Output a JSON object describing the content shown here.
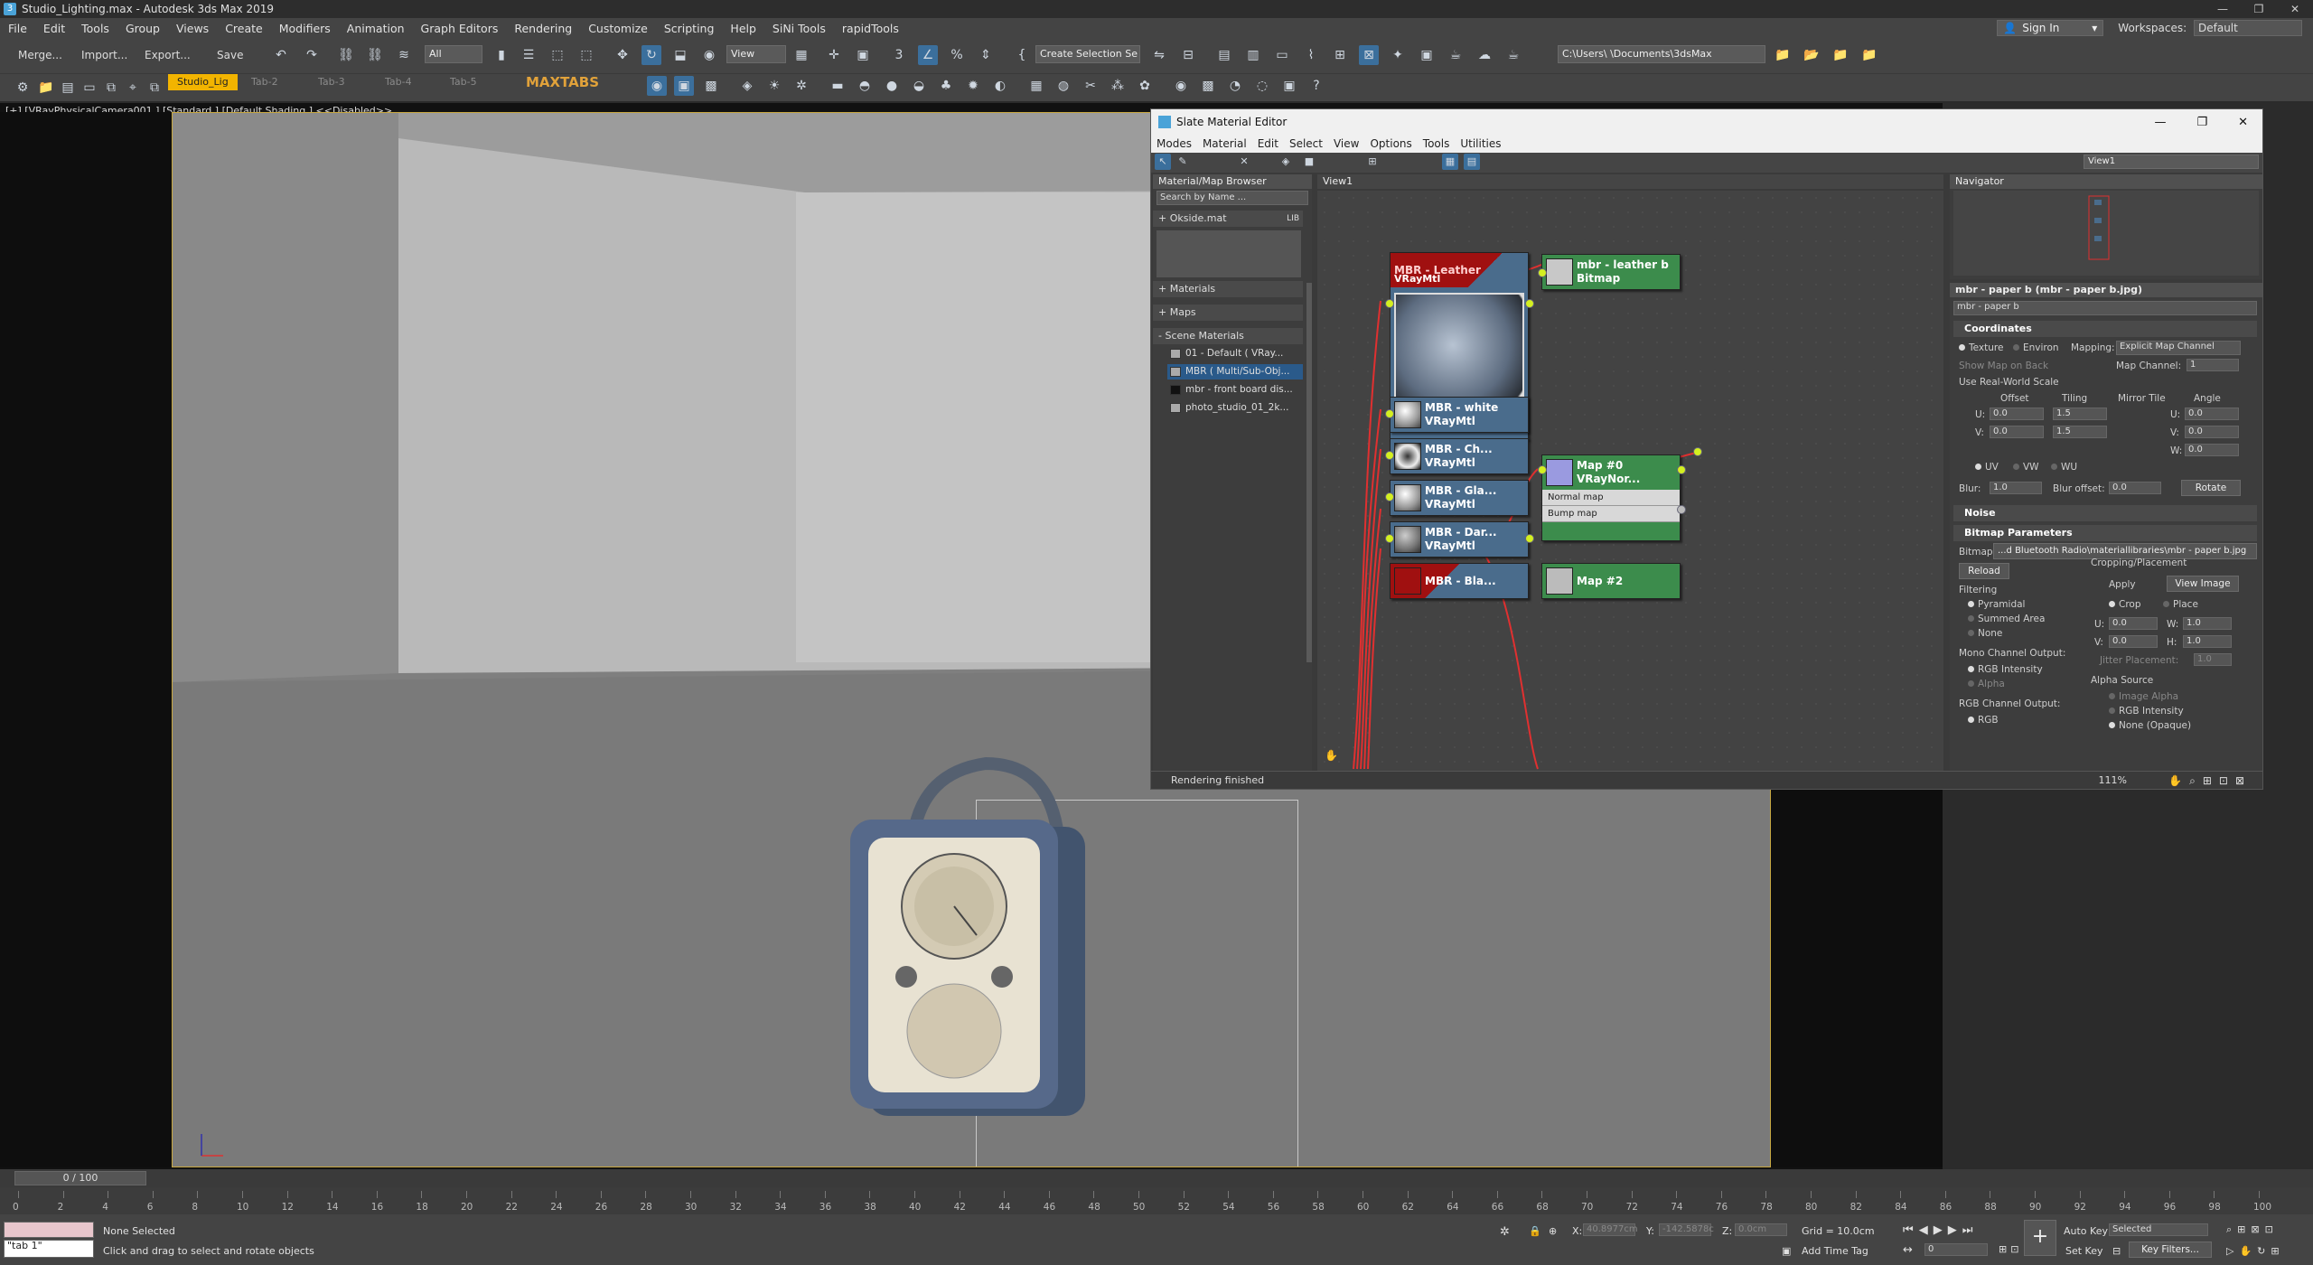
{
  "window": {
    "title": "Studio_Lighting.max - Autodesk 3ds Max 2019",
    "controls": [
      "—",
      "❐",
      "✕"
    ]
  },
  "menubar": {
    "items": [
      "File",
      "Edit",
      "Tools",
      "Group",
      "Views",
      "Create",
      "Modifiers",
      "Animation",
      "Graph Editors",
      "Rendering",
      "Customize",
      "Scripting",
      "Help",
      "SiNi Tools",
      "rapidTools"
    ],
    "sign_in": "Sign In",
    "workspaces_label": "Workspaces:",
    "workspace_value": "Default"
  },
  "toolbar": {
    "merge": "Merge...",
    "import": "Import...",
    "export": "Export...",
    "save": "Save",
    "filter": "All",
    "view": "View",
    "selection_set": "Create Selection Se",
    "path": "C:\\Users\\        \\Documents\\3dsMax"
  },
  "tabs": {
    "items": [
      "Studio_Lig",
      "Tab-2",
      "Tab-3",
      "Tab-4",
      "Tab-5"
    ],
    "brand": "MAXTABS"
  },
  "viewport": {
    "label": "[+] [VRayPhysicalCamera001 ] [Standard ] [Default Shading ]  <<Disabled>>"
  },
  "slate": {
    "title": "Slate Material Editor",
    "menu": [
      "Modes",
      "Material",
      "Edit",
      "Select",
      "View",
      "Options",
      "Tools",
      "Utilities"
    ],
    "view_dropdown": "View1",
    "browser": {
      "header": "Material/Map Browser",
      "search": "Search by Name ...",
      "okside": "+ Okside.mat",
      "lib": "LIB",
      "materials": "+ Materials",
      "maps": "+ Maps",
      "scene_materials": "- Scene Materials",
      "scene_items": [
        "01 - Default  ( VRay...",
        "MBR  ( Multi/Sub-Obj...",
        "mbr - front board dis...",
        "photo_studio_01_2k..."
      ]
    },
    "view_tab": "View1",
    "nodes": {
      "leather_mtl": [
        "MBR - Leather",
        "VRayMtl"
      ],
      "leather_bitmap": [
        "mbr - leather b",
        "Bitmap"
      ],
      "white": [
        "MBR - white",
        "VRayMtl"
      ],
      "chrome": [
        "MBR - Ch...",
        "VRayMtl"
      ],
      "glass": [
        "MBR - Gla...",
        "VRayMtl"
      ],
      "dark": [
        "MBR - Dar...",
        "VRayMtl"
      ],
      "black": [
        "MBR - Bla..."
      ],
      "map0": [
        "Map #0",
        "VRayNor..."
      ],
      "map0_slots": [
        "Normal map",
        "Bump map"
      ],
      "map2": [
        "Map #2"
      ]
    },
    "navigator": "Navigator",
    "params": {
      "header": "mbr - paper b  (mbr - paper b.jpg)",
      "name": "mbr - paper b",
      "coordinates": "Coordinates",
      "texture": "Texture",
      "environ": "Environ",
      "mapping_label": "Mapping:",
      "mapping_value": "Explicit Map Channel",
      "show_map_on_back": "Show Map on Back",
      "map_channel_label": "Map Channel:",
      "map_channel_value": "1",
      "real_world": "Use Real-World Scale",
      "offset": "Offset",
      "tiling": "Tiling",
      "mirror_tile": "Mirror Tile",
      "angle": "Angle",
      "u_offset": "0.0",
      "v_offset": "0.0",
      "u_tiling": "1.5",
      "v_tiling": "1.5",
      "angle_u": "0.0",
      "angle_v": "0.0",
      "angle_w": "0.0",
      "uv": "UV",
      "vw": "VW",
      "wu": "WU",
      "blur_label": "Blur:",
      "blur_value": "1.0",
      "blur_offset_label": "Blur offset:",
      "blur_offset_value": "0.0",
      "rotate": "Rotate",
      "noise": "Noise",
      "bitmap_params": "Bitmap Parameters",
      "bitmap_label": "Bitmap:",
      "bitmap_path": "...d Bluetooth Radio\\materiallibraries\\mbr - paper b.jpg",
      "reload": "Reload",
      "cropping": "Cropping/Placement",
      "apply": "Apply",
      "view_image": "View Image",
      "crop": "Crop",
      "place": "Place",
      "filtering": "Filtering",
      "pyramidal": "Pyramidal",
      "summed_area": "Summed Area",
      "none": "None",
      "mono_output": "Mono Channel Output:",
      "rgb_intensity": "RGB Intensity",
      "alpha": "Alpha",
      "rgb_output": "RGB Channel Output:",
      "rgb": "RGB",
      "crop_u": "0.0",
      "crop_v": "0.0",
      "crop_w": "1.0",
      "crop_h": "1.0",
      "jitter": "Jitter Placement:",
      "jitter_value": "1.0",
      "alpha_source": "Alpha Source",
      "image_alpha": "Image Alpha",
      "rgb_intensity2": "RGB Intensity",
      "none_opaque": "None (Opaque)"
    },
    "status": "Rendering finished",
    "zoom": "111%"
  },
  "timeline": {
    "frame": "0 / 100",
    "ticks": [
      "0",
      "2",
      "4",
      "6",
      "8",
      "10",
      "12",
      "14",
      "16",
      "18",
      "20",
      "22",
      "24",
      "26",
      "28",
      "30",
      "32",
      "34",
      "36",
      "38",
      "40",
      "42",
      "44",
      "46",
      "48",
      "50",
      "52",
      "54",
      "56",
      "58",
      "60",
      "62",
      "64",
      "66",
      "68",
      "70",
      "72",
      "74",
      "76",
      "78",
      "80",
      "82",
      "84",
      "86",
      "88",
      "90",
      "92",
      "94",
      "96",
      "98",
      "100"
    ]
  },
  "statusbar": {
    "script": "\"tab 1\"",
    "selection": "None Selected",
    "hint": "Click and drag to select and rotate objects",
    "x_label": "X:",
    "x_value": "40.8977cm",
    "y_label": "Y:",
    "y_value": "-142.5878c",
    "z_label": "Z:",
    "z_value": "0.0cm",
    "grid": "Grid = 10.0cm",
    "add_time_tag": "Add Time Tag",
    "auto_key": "Auto Key",
    "selected": "Selected",
    "set_key": "Set Key",
    "key_filters": "Key Filters...",
    "frame_field": "0"
  },
  "colors": {
    "accent": "#f2b400",
    "socket": "#d4f020",
    "wire": "#e03030",
    "vraymtl": "#4a6c8c",
    "bitmap": "#3c8c4c"
  }
}
